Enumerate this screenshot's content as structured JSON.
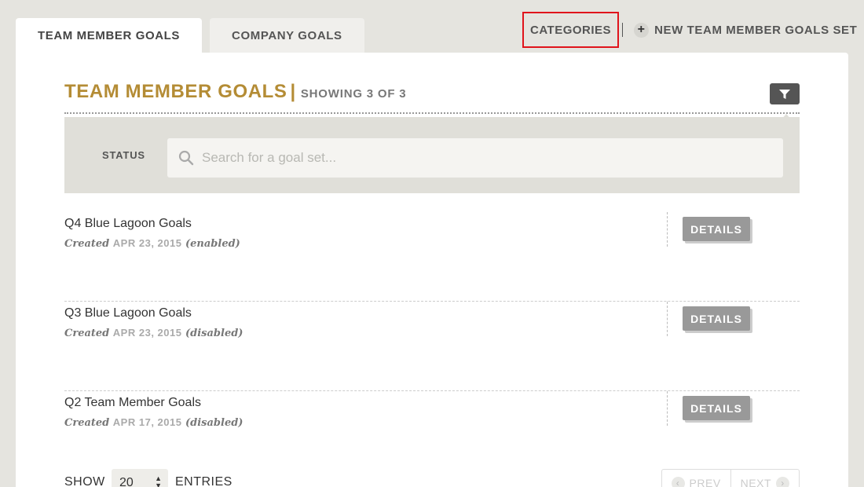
{
  "tabs": [
    {
      "label": "TEAM MEMBER GOALS",
      "active": true
    },
    {
      "label": "COMPANY GOALS",
      "active": false
    }
  ],
  "top_actions": {
    "categories_label": "CATEGORIES",
    "new_set_label": "NEW TEAM MEMBER GOALS SET"
  },
  "panel": {
    "title": "TEAM MEMBER GOALS",
    "separator": "|",
    "showing": "SHOWING 3 OF 3",
    "filter": {
      "status_label": "STATUS",
      "search_placeholder": "Search for a goal set..."
    }
  },
  "goal_sets": [
    {
      "name": "Q4 Blue Lagoon Goals",
      "created_prefix": "Created",
      "date": "APR 23, 2015",
      "state": "(enabled)",
      "button": "DETAILS"
    },
    {
      "name": "Q3 Blue Lagoon Goals",
      "created_prefix": "Created",
      "date": "APR 23, 2015",
      "state": "(disabled)",
      "button": "DETAILS"
    },
    {
      "name": "Q2 Team Member Goals",
      "created_prefix": "Created",
      "date": "APR 17, 2015",
      "state": "(disabled)",
      "button": "DETAILS"
    }
  ],
  "footer": {
    "show_label": "SHOW",
    "entries_value": "20",
    "entries_label": "ENTRIES",
    "prev_label": "PREV",
    "next_label": "NEXT"
  },
  "colors": {
    "accent": "#b48c35",
    "highlight_box": "#e0141c",
    "background": "#e5e4df"
  }
}
